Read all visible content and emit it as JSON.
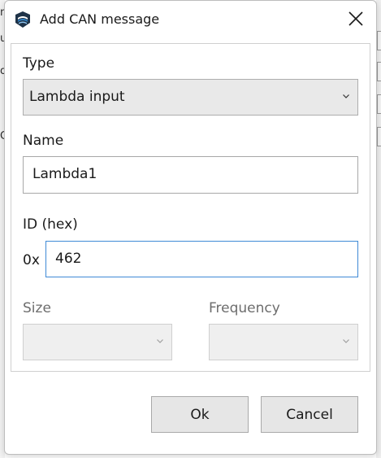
{
  "background_window": {
    "left_glyphs": [
      "n",
      "u",
      "o",
      "C"
    ]
  },
  "dialog": {
    "title": "Add CAN message",
    "icons": {
      "app": "app-logo-icon",
      "close": "close-icon",
      "dropdown": "chevron-down-icon"
    },
    "type": {
      "label": "Type",
      "selected": "Lambda input"
    },
    "name": {
      "label": "Name",
      "value": "Lambda1"
    },
    "id": {
      "label": "ID (hex)",
      "prefix": "0x",
      "value": "462"
    },
    "size": {
      "label": "Size",
      "selected": ""
    },
    "frequency": {
      "label": "Frequency",
      "selected": ""
    },
    "buttons": {
      "ok": "Ok",
      "cancel": "Cancel"
    }
  },
  "colors": {
    "focus_border": "#3f8ad6",
    "button_bg": "#e6e6e6",
    "combo_bg": "#e9e9e9",
    "icon_blue": "#2f7fc1",
    "icon_dark": "#1f3348"
  }
}
